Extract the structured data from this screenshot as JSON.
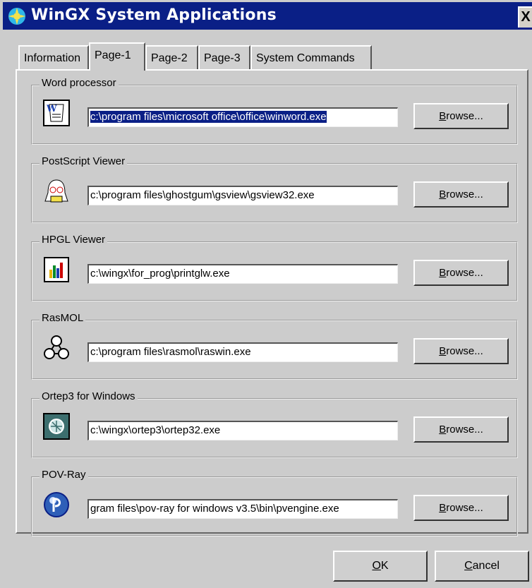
{
  "window": {
    "title": "WinGX System Applications",
    "close_label": "X"
  },
  "tabs": [
    {
      "label": "Information"
    },
    {
      "label": "Page-1"
    },
    {
      "label": "Page-2"
    },
    {
      "label": "Page-3"
    },
    {
      "label": "System Commands"
    }
  ],
  "active_tab": "Page-1",
  "groups": [
    {
      "label": "Word processor",
      "path": "c:\\program files\\microsoft office\\office\\winword.exe",
      "icon": "word-processor-icon",
      "browse": {
        "pre": "",
        "key": "B",
        "post": "rowse..."
      }
    },
    {
      "label": "PostScript Viewer",
      "path": "c:\\program files\\ghostgum\\gsview\\gsview32.exe",
      "icon": "ghost-icon",
      "browse": {
        "pre": "",
        "key": "B",
        "post": "rowse..."
      }
    },
    {
      "label": "HPGL Viewer",
      "path": "c:\\wingx\\for_prog\\printglw.exe",
      "icon": "bar-chart-icon",
      "browse": {
        "pre": "",
        "key": "B",
        "post": "rowse..."
      }
    },
    {
      "label": "RasMOL",
      "path": "c:\\program files\\rasmol\\raswin.exe",
      "icon": "molecule-icon",
      "browse": {
        "pre": "",
        "key": "B",
        "post": "rowse..."
      }
    },
    {
      "label": "Ortep3 for Windows",
      "path": "c:\\wingx\\ortep3\\ortep32.exe",
      "icon": "ortep-icon",
      "browse": {
        "pre": "",
        "key": "B",
        "post": "rowse..."
      }
    },
    {
      "label": "POV-Ray",
      "path": "gram files\\pov-ray for windows v3.5\\bin\\pvengine.exe",
      "icon": "povray-icon",
      "browse": {
        "pre": "",
        "key": "B",
        "post": "rowse..."
      }
    }
  ],
  "buttons": {
    "ok": {
      "key": "O",
      "post": "K"
    },
    "cancel": {
      "key": "C",
      "post": "ancel"
    }
  },
  "colors": {
    "titlebar": "#0a1f86",
    "selection": "#0a1f86",
    "face": "#cccccc"
  }
}
